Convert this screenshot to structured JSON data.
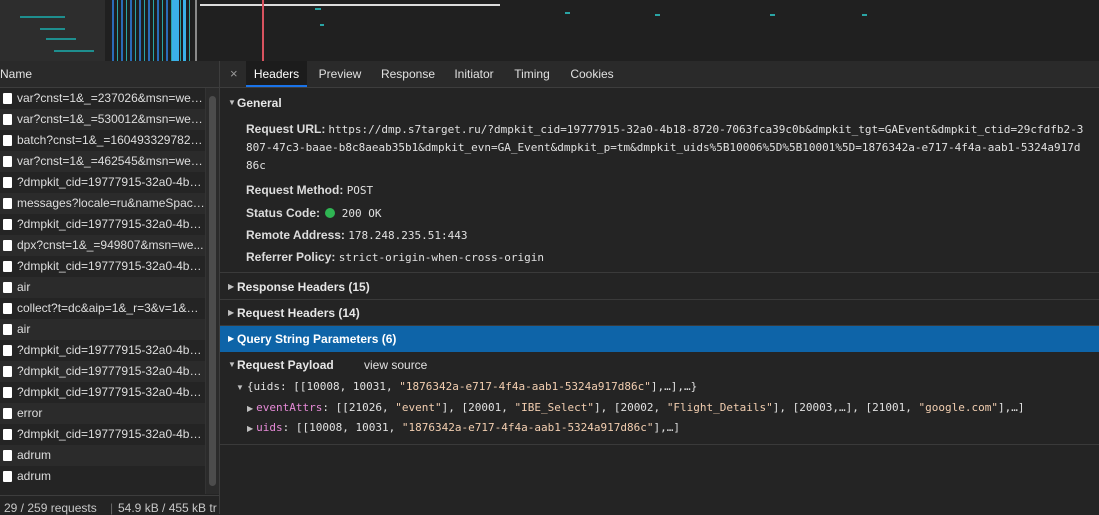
{
  "name_column": {
    "header": "Name"
  },
  "requests": [
    "var?cnst=1&_=237026&msn=web...",
    "var?cnst=1&_=530012&msn=web...",
    "batch?cnst=1&_=1604933297826...",
    "var?cnst=1&_=462545&msn=web...",
    "?dmpkit_cid=19777915-32a0-4b1...",
    "messages?locale=ru&nameSpace...",
    "?dmpkit_cid=19777915-32a0-4b1...",
    "dpx?cnst=1&_=949807&msn=we...",
    "?dmpkit_cid=19777915-32a0-4b1...",
    "air",
    "collect?t=dc&aip=1&_r=3&v=1&_v...",
    "air",
    "?dmpkit_cid=19777915-32a0-4b1...",
    "?dmpkit_cid=19777915-32a0-4b1...",
    "?dmpkit_cid=19777915-32a0-4b1...",
    "error",
    "?dmpkit_cid=19777915-32a0-4b1...",
    "adrum",
    "adrum"
  ],
  "status_bar": {
    "requests": "29 / 259 requests",
    "transferred": "54.9 kB / 455 kB tr"
  },
  "tabs": [
    "Headers",
    "Preview",
    "Response",
    "Initiator",
    "Timing",
    "Cookies"
  ],
  "active_tab": "Headers",
  "close_icon": "×",
  "general": {
    "title": "General",
    "request_url_label": "Request URL:",
    "request_url": "https://dmp.s7target.ru/?dmpkit_cid=19777915-32a0-4b18-8720-7063fca39c0b&dmpkit_tgt=GAEvent&dmpkit_ctid=29cfdfb2-3807-47c3-baae-b8c8aeab35b1&dmpkit_evn=GA_Event&dmpkit_p=tm&dmpkit_uids%5B10006%5D%5B10001%5D=1876342a-e717-4f4a-aab1-5324a917d86c",
    "method_label": "Request Method:",
    "method": "POST",
    "status_label": "Status Code:",
    "status": "200 OK",
    "status_color": "#2fb553",
    "remote_label": "Remote Address:",
    "remote": "178.248.235.51:443",
    "referrer_label": "Referrer Policy:",
    "referrer": "strict-origin-when-cross-origin"
  },
  "sections": {
    "response_headers": "Response Headers (15)",
    "request_headers": "Request Headers (14)",
    "query_string": "Query String Parameters (6)",
    "request_payload": "Request Payload",
    "view_source": "view source"
  },
  "payload": {
    "root_prefix": "{uids: [[10008, 10031, ",
    "root_str": "\"1876342a-e717-4f4a-aab1-5324a917d86c\"",
    "root_suffix": "],…],…}",
    "event_key": "eventAttrs",
    "event_value_a": ": [[21026, ",
    "event_s1": "\"event\"",
    "event_value_b": "], [20001, ",
    "event_s2": "\"IBE_Select\"",
    "event_value_c": "], [20002, ",
    "event_s3": "\"Flight_Details\"",
    "event_value_d": "], [20003,…], [21001, ",
    "event_s4": "\"google.com\"",
    "event_value_e": "],…]",
    "uids_key": "uids",
    "uids_value_a": ": [[10008, 10031, ",
    "uids_str": "\"1876342a-e717-4f4a-aab1-5324a917d86c\"",
    "uids_value_b": "],…]"
  },
  "icons": {
    "file": "file-icon",
    "expand": "triangle-right-icon",
    "collapse": "triangle-down-icon",
    "status": "status-dot-icon"
  },
  "colors": {
    "accent": "#1a73e8",
    "selected_section": "#0e64a8",
    "key_pink": "#e68ad7"
  }
}
